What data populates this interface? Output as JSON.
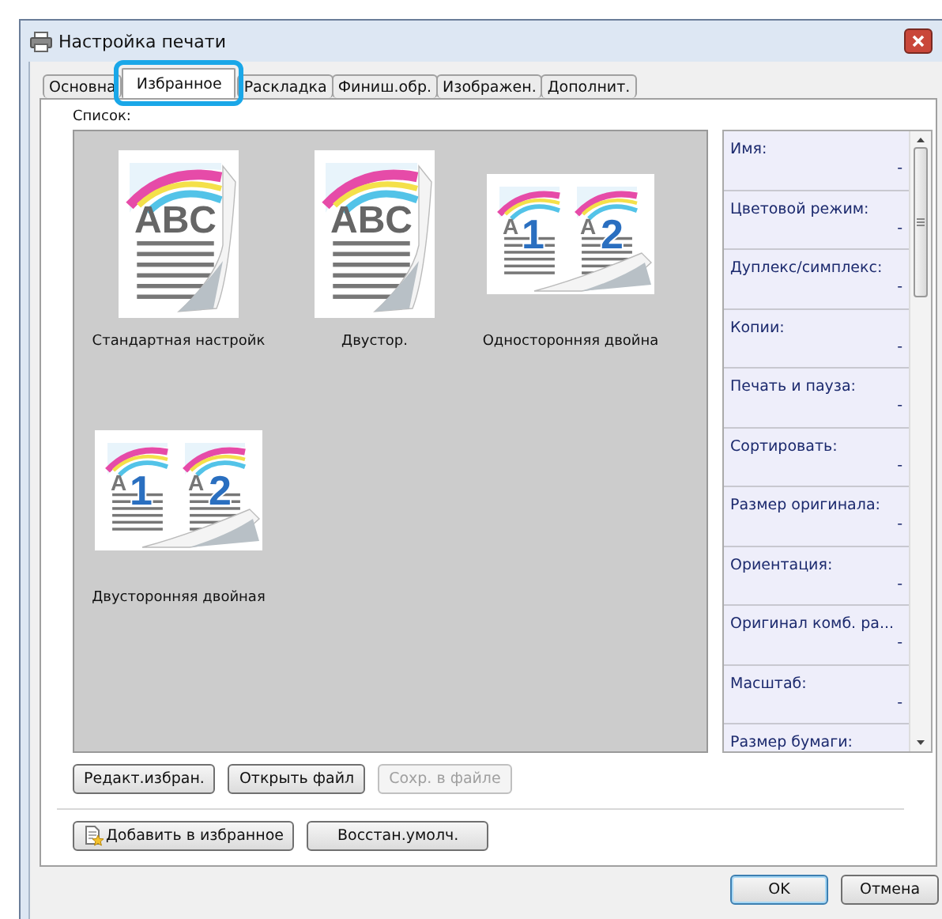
{
  "window": {
    "title": "Настройка печати"
  },
  "tabs": [
    {
      "label": "Основна",
      "selected": false
    },
    {
      "label": "Избранное",
      "selected": true
    },
    {
      "label": "Раскладка",
      "selected": false
    },
    {
      "label": "Финиш.обр.",
      "selected": false
    },
    {
      "label": "Изображен.",
      "selected": false
    },
    {
      "label": "Дополнит.",
      "selected": false
    }
  ],
  "list": {
    "label": "Список:",
    "items": [
      {
        "kind": "single",
        "art_text": "ABC",
        "name": "Стандартная настройк"
      },
      {
        "kind": "single",
        "art_text": "ABC",
        "name": "Двустор."
      },
      {
        "kind": "double",
        "art_texts": [
          "A",
          "A"
        ],
        "page_numbers": [
          "1",
          "2"
        ],
        "name": "Односторонняя двойна"
      },
      {
        "kind": "double",
        "art_texts": [
          "A",
          "A"
        ],
        "page_numbers": [
          "1",
          "2"
        ],
        "name": "Двусторонняя двойная"
      }
    ]
  },
  "properties": [
    {
      "label": "Имя:",
      "value": "-"
    },
    {
      "label": "Цветовой режим:",
      "value": "-"
    },
    {
      "label": "Дуплекс/симплекс:",
      "value": "-"
    },
    {
      "label": "Копии:",
      "value": "-"
    },
    {
      "label": "Печать и пауза:",
      "value": "-"
    },
    {
      "label": "Сортировать:",
      "value": "-"
    },
    {
      "label": "Размер оригинала:",
      "value": "-"
    },
    {
      "label": "Ориентация:",
      "value": "-"
    },
    {
      "label": "Оригинал комб. ра...",
      "value": "-"
    },
    {
      "label": "Масштаб:",
      "value": "-"
    },
    {
      "label": "Размер бумаги:"
    }
  ],
  "list_buttons": [
    {
      "label": "Редакт.избран.",
      "disabled": false
    },
    {
      "label": "Открыть файл",
      "disabled": false
    },
    {
      "label": "Сохр. в файле",
      "disabled": true
    }
  ],
  "favorite_buttons": [
    {
      "label": "Добавить в избранное",
      "kind": "icon"
    },
    {
      "label": "Восстан.умолч.",
      "kind": "plain"
    }
  ],
  "dialog_buttons": [
    {
      "label": "OK",
      "kind": "default"
    },
    {
      "label": "Отмена",
      "kind": "normal"
    }
  ]
}
